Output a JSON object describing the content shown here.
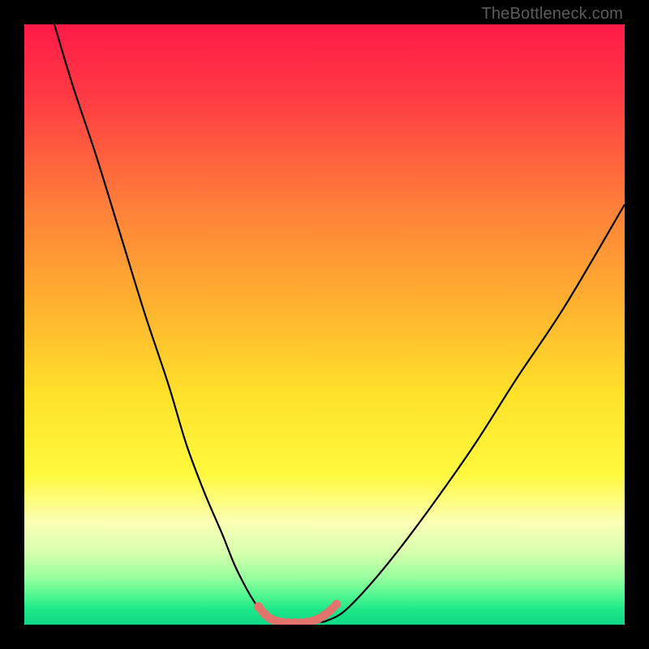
{
  "watermark": "TheBottleneck.com",
  "chart_data": {
    "type": "line",
    "title": "",
    "xlabel": "",
    "ylabel": "",
    "xlim": [
      0,
      100
    ],
    "ylim": [
      0,
      100
    ],
    "grid": false,
    "legend": false,
    "background_gradient": {
      "stops": [
        {
          "pos": 0.0,
          "color": "#ff1b48"
        },
        {
          "pos": 0.12,
          "color": "#ff3a44"
        },
        {
          "pos": 0.3,
          "color": "#ff7e3a"
        },
        {
          "pos": 0.48,
          "color": "#ffb62f"
        },
        {
          "pos": 0.62,
          "color": "#ffe22a"
        },
        {
          "pos": 0.75,
          "color": "#fff93e"
        },
        {
          "pos": 0.83,
          "color": "#fbffb5"
        },
        {
          "pos": 0.88,
          "color": "#d6ffad"
        },
        {
          "pos": 0.92,
          "color": "#9bff9f"
        },
        {
          "pos": 0.955,
          "color": "#49f58f"
        },
        {
          "pos": 0.975,
          "color": "#1de788"
        },
        {
          "pos": 1.0,
          "color": "#0fd985"
        }
      ]
    },
    "series": [
      {
        "name": "bottleneck-curve-left",
        "color": "#000000",
        "x": [
          5,
          8,
          12,
          16,
          20,
          24,
          27,
          30,
          33,
          35,
          37,
          38.5,
          40,
          41.5
        ],
        "y": [
          100,
          90,
          78,
          65,
          52,
          40,
          30,
          22,
          15,
          10,
          6,
          3.5,
          1.5,
          0.5
        ]
      },
      {
        "name": "bottleneck-curve-flat",
        "color": "#000000",
        "x": [
          41.5,
          44,
          47,
          50
        ],
        "y": [
          0.5,
          0.2,
          0.2,
          0.5
        ]
      },
      {
        "name": "bottleneck-curve-right",
        "color": "#000000",
        "x": [
          50,
          53,
          57,
          62,
          68,
          75,
          82,
          90,
          100
        ],
        "y": [
          0.5,
          2,
          6,
          12,
          20,
          30,
          41,
          53,
          70
        ]
      },
      {
        "name": "sweet-spot-marker",
        "color": "#e2746d",
        "type": "scatter",
        "x": [
          39,
          40,
          41,
          42,
          43,
          44,
          45,
          46,
          47,
          48,
          49,
          50,
          51,
          52
        ],
        "y": [
          3.0,
          1.8,
          1.0,
          0.6,
          0.4,
          0.3,
          0.3,
          0.3,
          0.4,
          0.6,
          1.0,
          1.6,
          2.4,
          3.4
        ]
      }
    ]
  }
}
